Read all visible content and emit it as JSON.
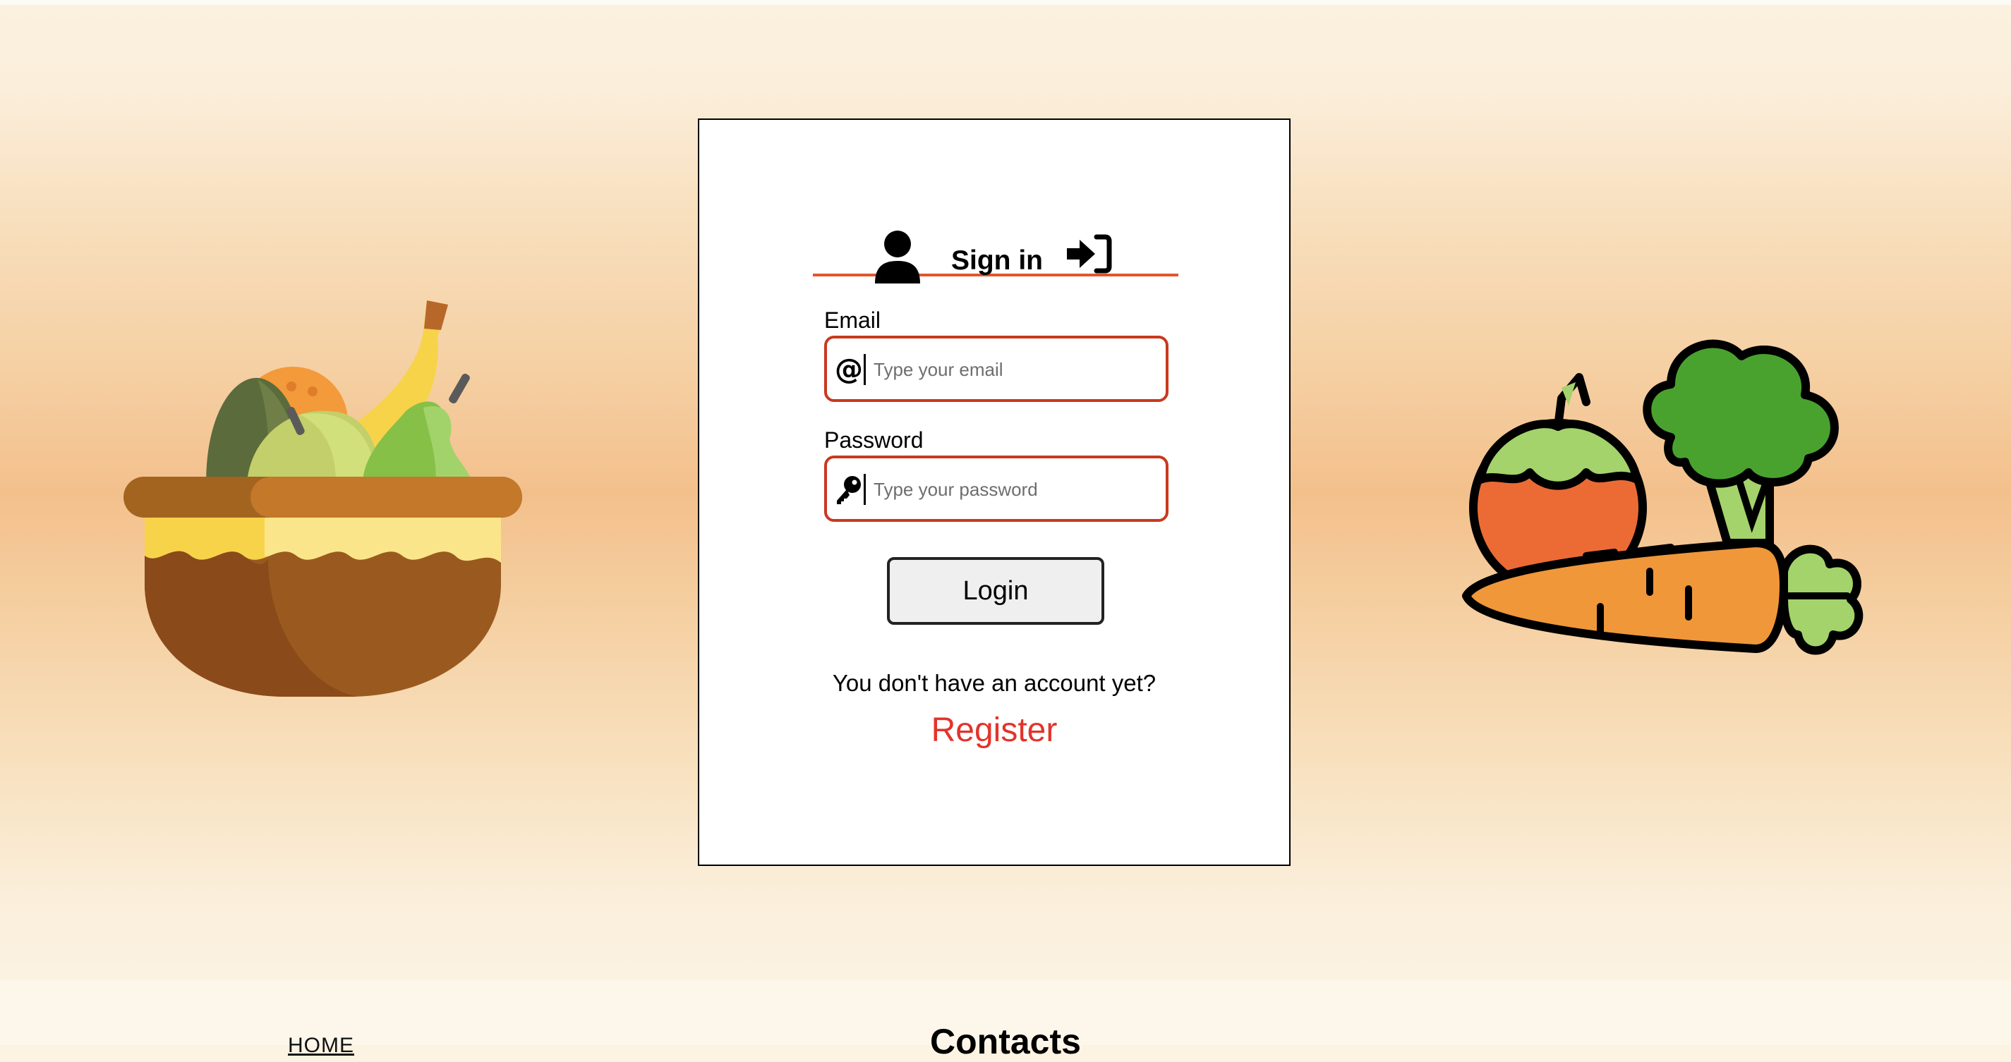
{
  "signin": {
    "title": "Sign in",
    "email_label": "Email",
    "email_placeholder": "Type your email",
    "password_label": "Password",
    "password_placeholder": "Type your password",
    "login_button": "Login",
    "no_account_text": "You don't have an account yet?",
    "register_link": "Register"
  },
  "footer": {
    "home_link": "HOME",
    "contacts_heading": "Contacts"
  },
  "icons": {
    "user": "user-icon",
    "sign_in": "sign-in-icon",
    "email": "at-sign-icon",
    "password": "key-icon",
    "left_illustration": "fruit-basket-illustration",
    "right_illustration": "vegetables-illustration"
  },
  "colors": {
    "accent": "#e2552b",
    "input_border": "#c8391f",
    "register": "#e2342b",
    "button_bg": "#efefef"
  }
}
